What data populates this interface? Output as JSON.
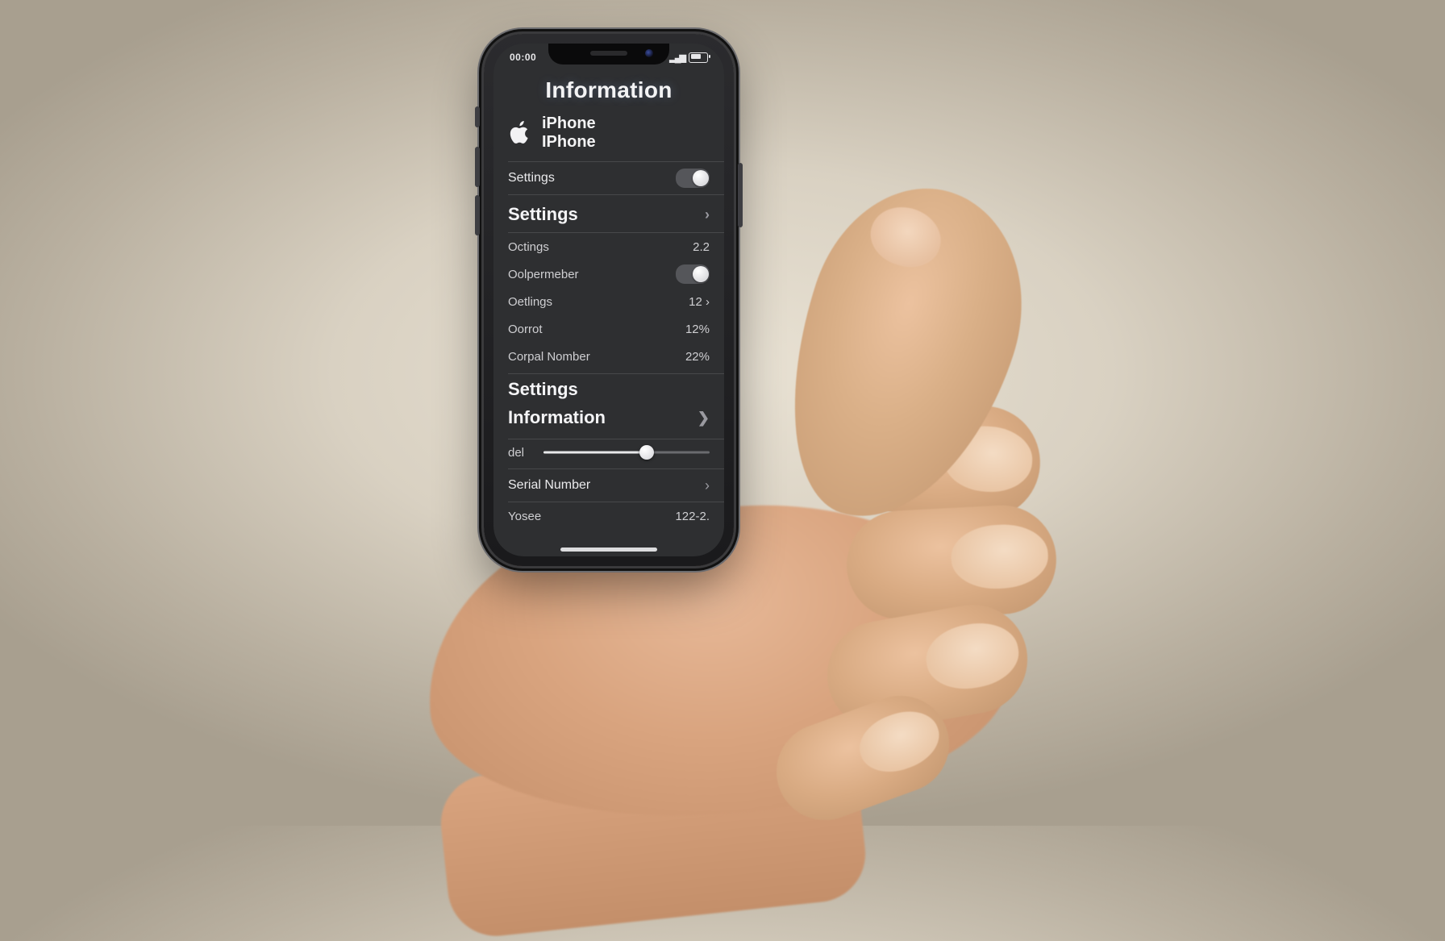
{
  "statusbar": {
    "time": "00:00",
    "signal_icon": "signal-icon",
    "battery_icon": "battery-icon"
  },
  "header": {
    "title": "Information"
  },
  "device": {
    "line1": "iPhone",
    "line2": "IPhone",
    "icon": "apple-logo-icon"
  },
  "rows": {
    "settings_toggle": {
      "label": "Settings"
    },
    "settings_link": {
      "label": "Settings"
    }
  },
  "group1": [
    {
      "label": "Octings",
      "value": "2.2"
    },
    {
      "label": "Oolpermeber",
      "toggle": true
    },
    {
      "label": "Oetlings",
      "value": "12 ›"
    },
    {
      "label": "Oorrot",
      "value": "12%"
    },
    {
      "label": "Corpal Nomber",
      "value": "22%"
    }
  ],
  "section2": {
    "title1": "Settings",
    "title2": "Information"
  },
  "slider": {
    "label": "del"
  },
  "serial": {
    "label": "Serial Number"
  },
  "footer_row": {
    "label": "Yosee",
    "value": "122-2."
  }
}
